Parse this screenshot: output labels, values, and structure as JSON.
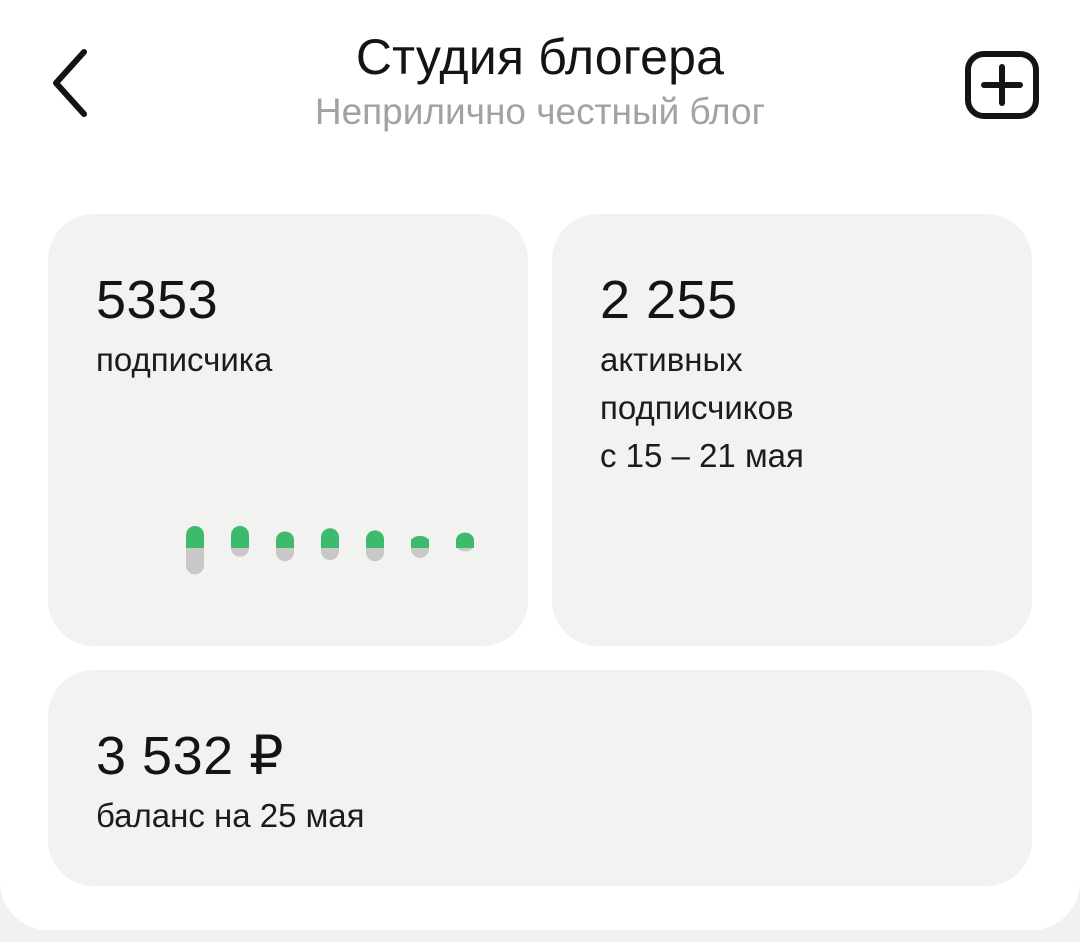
{
  "header": {
    "title": "Студия блогера",
    "subtitle": "Неприлично честный блог",
    "back_icon": "chevron-left-icon",
    "add_icon": "plus-square-icon"
  },
  "subscribers": {
    "count": "5353",
    "label": "подписчика",
    "mini_chart": {
      "colors": {
        "gain": "#3dba6c",
        "loss": "#c8c8c8"
      },
      "bars": [
        {
          "gain": 1.0,
          "loss": 1.2
        },
        {
          "gain": 1.0,
          "loss": 0.4
        },
        {
          "gain": 0.75,
          "loss": 0.6
        },
        {
          "gain": 0.9,
          "loss": 0.55
        },
        {
          "gain": 0.8,
          "loss": 0.6
        },
        {
          "gain": 0.55,
          "loss": 0.45
        },
        {
          "gain": 0.7,
          "loss": 0.15
        }
      ]
    }
  },
  "active": {
    "count": "2 255",
    "line1": "активных",
    "line2": "подписчиков",
    "line3": "с 15 – 21 мая"
  },
  "balance": {
    "amount": "3 532 ₽",
    "label": "баланс на 25 мая"
  }
}
